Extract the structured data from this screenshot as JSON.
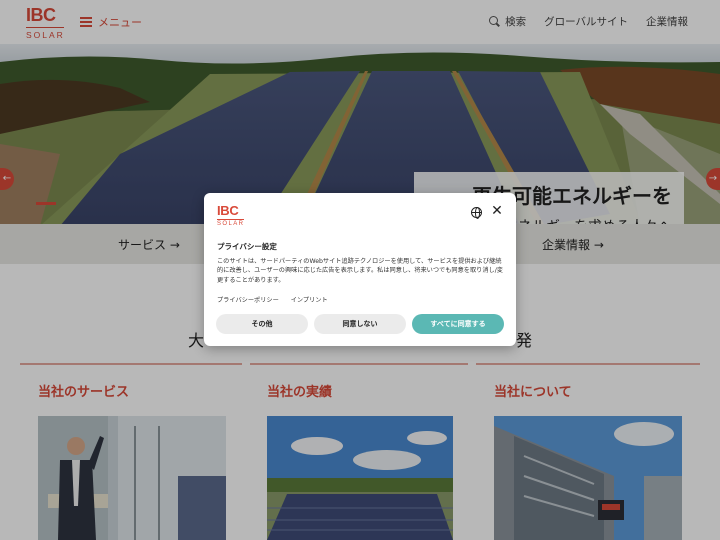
{
  "header": {
    "logo_brand": "IBC",
    "logo_sub": "SOLAR",
    "menu_label": "メニュー",
    "search_label": "検索",
    "global_site_label": "グローバルサイト",
    "company_info_label": "企業情報",
    "icons": [
      "hamburger-icon",
      "search-icon"
    ]
  },
  "hero": {
    "headline": "再生可能エネルギーを",
    "subline": "新世代のエネルギーを求める人々へ",
    "prev_arrow": "←",
    "next_arrow": "→"
  },
  "quick_links": {
    "services": "サービス →",
    "company": "企業情報 →"
  },
  "mission": {
    "left_char": "大",
    "right_char": "発"
  },
  "columns": [
    {
      "title": "当社のサービス"
    },
    {
      "title": "当社の実績"
    },
    {
      "title": "当社について"
    }
  ],
  "cookie_dialog": {
    "logo_brand": "IBC",
    "logo_sub": "SOLAR",
    "title": "プライバシー設定",
    "body": "このサイトは、サードパーティのWebサイト追跡テクノロジーを使用して、サービスを提供および継続的に改善し、ユーザーの興味に応じた広告を表示します。私は同意し、将来いつでも同意を取り消し/変更することがあります。",
    "privacy_policy_link": "プライバシーポリシー",
    "imprint_link": "インプリント",
    "other_button": "その他",
    "deny_button": "同意しない",
    "accept_all_button": "すべてに同意する",
    "close_symbol": "✕",
    "accent_color": "#5bb8b4"
  },
  "colors": {
    "brand_red": "#d94a3a",
    "accept_teal": "#5bb8b4"
  }
}
